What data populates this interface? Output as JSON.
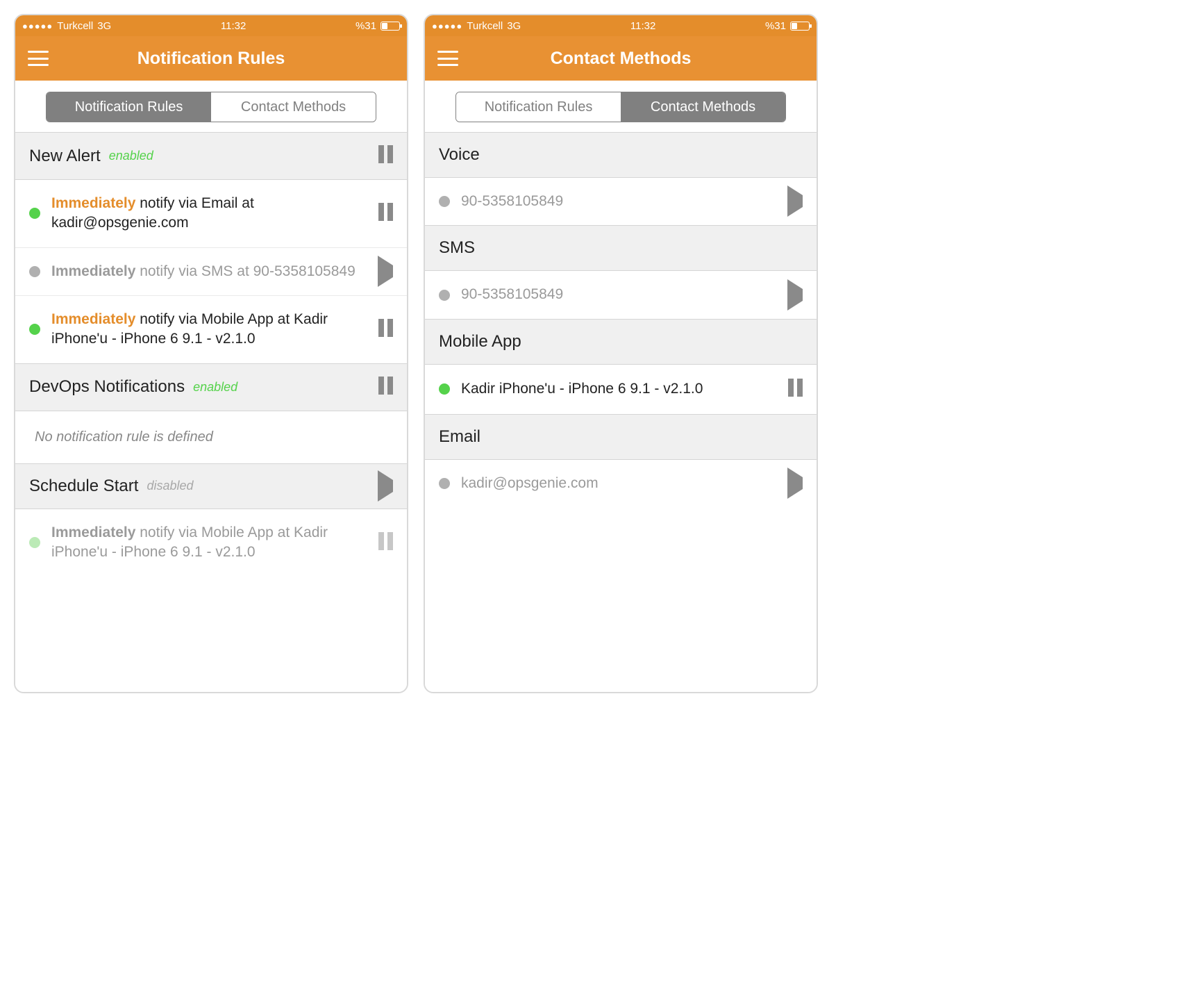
{
  "status": {
    "carrier": "Turkcell",
    "network": "3G",
    "time": "11:32",
    "battery_pct": "%31"
  },
  "screens": [
    {
      "title": "Notification Rules",
      "tabs": {
        "left": "Notification Rules",
        "right": "Contact Methods",
        "active": "left"
      },
      "sections": [
        {
          "title": "New Alert",
          "status": "enabled",
          "action": "pause",
          "rows": [
            {
              "dot": "green",
              "imm": "Immediately",
              "text_prefix": " notify via Email at ",
              "text_detail": "kadir@opsgenie.com",
              "action": "pause",
              "active": true
            },
            {
              "dot": "grey",
              "imm": "Immediately",
              "text_prefix": " notify via SMS at ",
              "text_detail": "90-5358105849",
              "action": "play",
              "active": false
            },
            {
              "dot": "green",
              "imm": "Immediately",
              "text_prefix": " notify via Mobile App at ",
              "text_detail": "Kadir iPhone'u - iPhone 6 9.1 - v2.1.0",
              "action": "pause",
              "active": true
            }
          ]
        },
        {
          "title": "DevOps Notifications",
          "status": "enabled",
          "action": "pause",
          "empty": "No notification rule is defined"
        },
        {
          "title": "Schedule Start",
          "status": "disabled",
          "action": "play",
          "rows": [
            {
              "dot": "green-faded",
              "imm": "Immediately",
              "text_prefix": " notify via Mobile App at ",
              "text_detail": "Kadir iPhone'u - iPhone 6 9.1 - v2.1.0",
              "action": "pause",
              "active": false,
              "faded": true
            }
          ]
        }
      ]
    },
    {
      "title": "Contact Methods",
      "tabs": {
        "left": "Notification Rules",
        "right": "Contact Methods",
        "active": "right"
      },
      "sections": [
        {
          "title": "Voice",
          "rows": [
            {
              "dot": "grey",
              "label": "90-5358105849",
              "action": "play",
              "active": false
            }
          ]
        },
        {
          "title": "SMS",
          "rows": [
            {
              "dot": "grey",
              "label": "90-5358105849",
              "action": "play",
              "active": false
            }
          ]
        },
        {
          "title": "Mobile App",
          "rows": [
            {
              "dot": "green",
              "label": "Kadir iPhone'u - iPhone 6 9.1 - v2.1.0",
              "action": "pause",
              "active": true
            }
          ]
        },
        {
          "title": "Email",
          "rows": [
            {
              "dot": "grey",
              "label": "kadir@opsgenie.com",
              "action": "play",
              "active": false
            }
          ]
        }
      ]
    }
  ]
}
